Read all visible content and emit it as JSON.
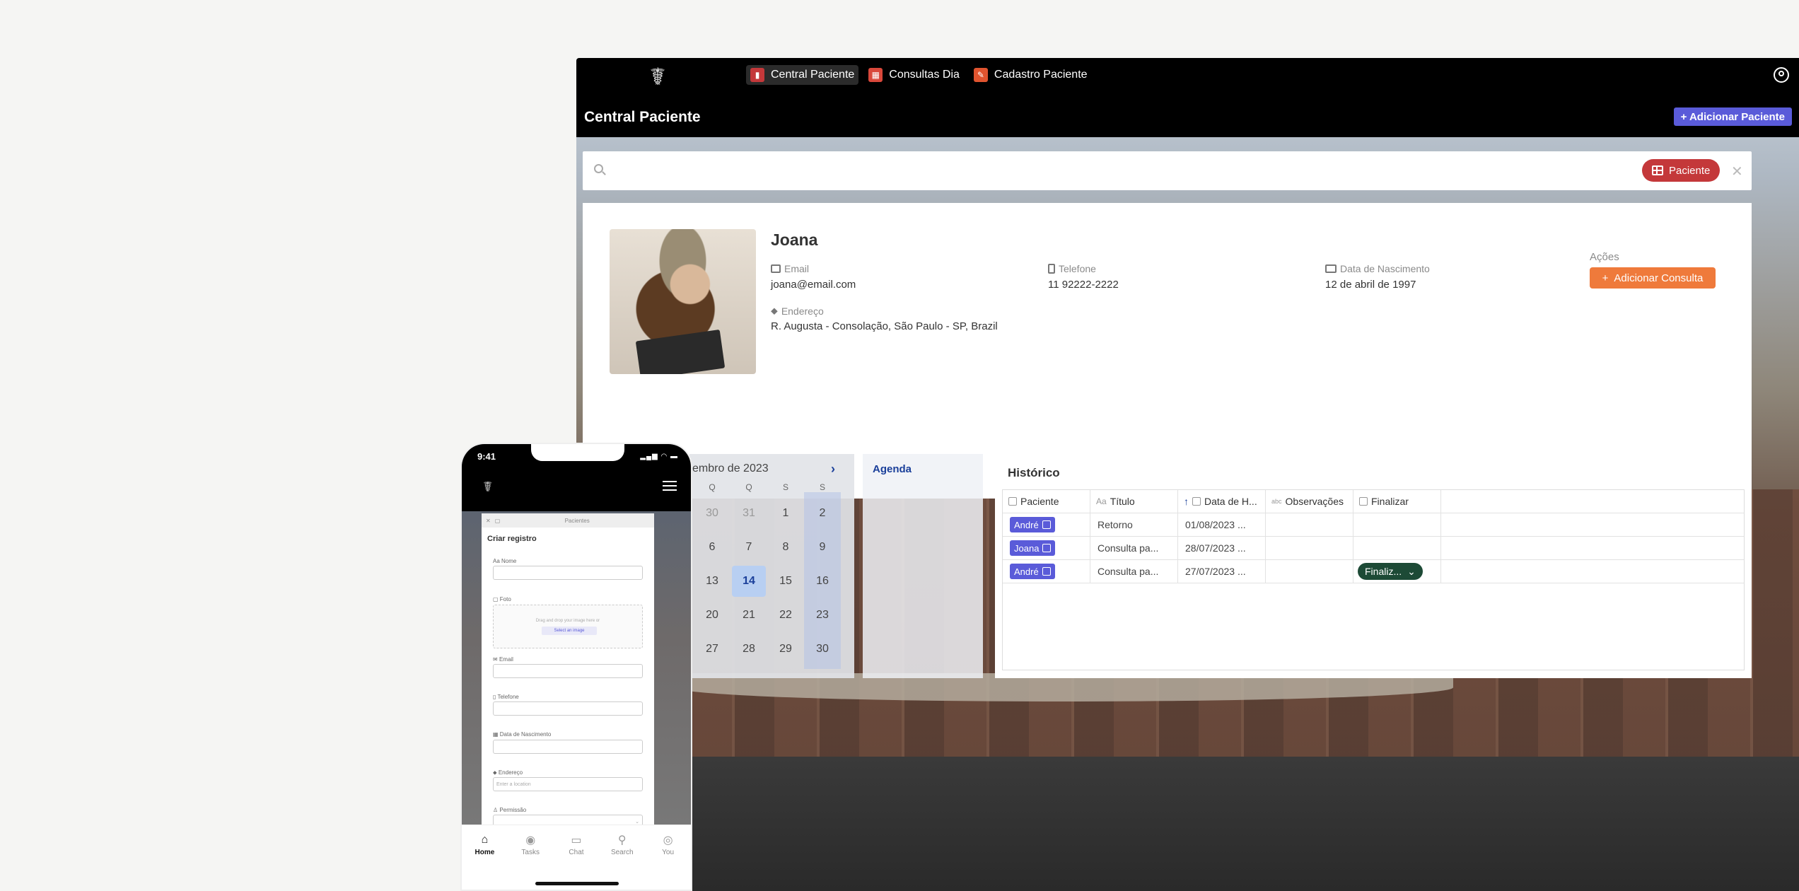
{
  "desktop": {
    "nav": [
      {
        "label": "Central Paciente",
        "active": true,
        "icon_color": "#c4383a"
      },
      {
        "label": "Consultas Dia",
        "active": false,
        "icon_color": "#d9483b"
      },
      {
        "label": "Cadastro Paciente",
        "active": false,
        "icon_color": "#e0542f"
      }
    ],
    "page_title": "Central Paciente",
    "add_patient_label": "+ Adicionar Paciente",
    "search": {
      "placeholder": "",
      "chip_label": "Paciente",
      "clear": "✕"
    },
    "patient": {
      "name": "Joana",
      "email_label": "Email",
      "email": "joana@email.com",
      "phone_label": "Telefone",
      "phone": "11 92222-2222",
      "birth_label": "Data de Nascimento",
      "birth": "12 de abril de 1997",
      "address_label": "Endereço",
      "address": "R. Augusta - Consolação, São Paulo - SP, Brazil",
      "actions_label": "Ações",
      "add_consult_label": "Adicionar Consulta"
    },
    "calendar": {
      "month_label": "embro de 2023",
      "next": "›",
      "weekdays": [
        "Q",
        "Q",
        "S",
        "S"
      ],
      "days": [
        [
          "30",
          "31",
          "1",
          "2"
        ],
        [
          "6",
          "7",
          "8",
          "9"
        ],
        [
          "13",
          "14",
          "15",
          "16"
        ],
        [
          "20",
          "21",
          "22",
          "23"
        ],
        [
          "27",
          "28",
          "29",
          "30"
        ]
      ],
      "today": "14"
    },
    "agenda_title": "Agenda",
    "history": {
      "title": "Histórico",
      "columns": [
        "Paciente",
        "Título",
        "Data de H...",
        "Observações",
        "Finalizar"
      ],
      "rows": [
        {
          "patient": "André",
          "title": "Retorno",
          "date": "01/08/2023 ...",
          "notes": "",
          "finish": ""
        },
        {
          "patient": "Joana",
          "title": "Consulta pa...",
          "date": "28/07/2023 ...",
          "notes": "",
          "finish": ""
        },
        {
          "patient": "André",
          "title": "Consulta pa...",
          "date": "27/07/2023 ...",
          "notes": "",
          "finish": "Finaliz..."
        }
      ]
    },
    "colors": {
      "accent": "#5a5bd9",
      "chip": "#c4383a",
      "action": "#ef7a3b",
      "finish": "#1d4a36"
    }
  },
  "phone": {
    "time": "9:41",
    "modal": {
      "header": "Pacientes",
      "title": "Criar registro",
      "fields": [
        {
          "label": "Nome",
          "value": ""
        },
        {
          "label": "Foto",
          "value": ""
        },
        {
          "label": "Email",
          "value": ""
        },
        {
          "label": "Telefone",
          "value": ""
        },
        {
          "label": "Data de Nascimento",
          "value": ""
        },
        {
          "label": "Endereço",
          "value": "Enter a location"
        },
        {
          "label": "Permissão",
          "value": ""
        }
      ],
      "drop_text": "Drag and drop your image here or",
      "drop_button": "Select an image"
    },
    "tabs": [
      {
        "label": "Home",
        "icon": "home-icon"
      },
      {
        "label": "Tasks",
        "icon": "check-circle-icon"
      },
      {
        "label": "Chat",
        "icon": "chat-icon"
      },
      {
        "label": "Search",
        "icon": "search-icon"
      },
      {
        "label": "You",
        "icon": "user-icon"
      }
    ]
  }
}
